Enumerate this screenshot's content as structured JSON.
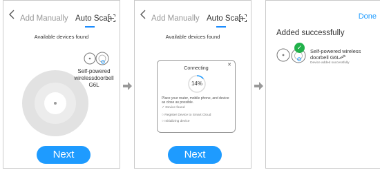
{
  "screen1": {
    "tab_manual": "Add Manually",
    "tab_auto": "Auto Scan",
    "available": "Available devices found",
    "device_name": "Self-powered wirelessdoorbell G6L",
    "next": "Next"
  },
  "screen2": {
    "tab_manual": "Add Manually",
    "tab_auto": "Auto Scan",
    "available": "Available devices found",
    "modal": {
      "title": "Connecting",
      "percent": "14%",
      "desc": "Place your router, mobile phone, and device as close as possible.",
      "steps": [
        "Device found",
        "Register Device to Smart Cloud",
        "Initializing device"
      ]
    },
    "next": "Next"
  },
  "screen3": {
    "done": "Done",
    "added": "Added successfully",
    "device_name_1": "Self-powered wireless",
    "device_name_2": "doorbell G6L",
    "device_sub": "Device added successfully"
  },
  "colors": {
    "accent": "#1e9bff",
    "success": "#21b14a"
  },
  "progress_percent": 14
}
